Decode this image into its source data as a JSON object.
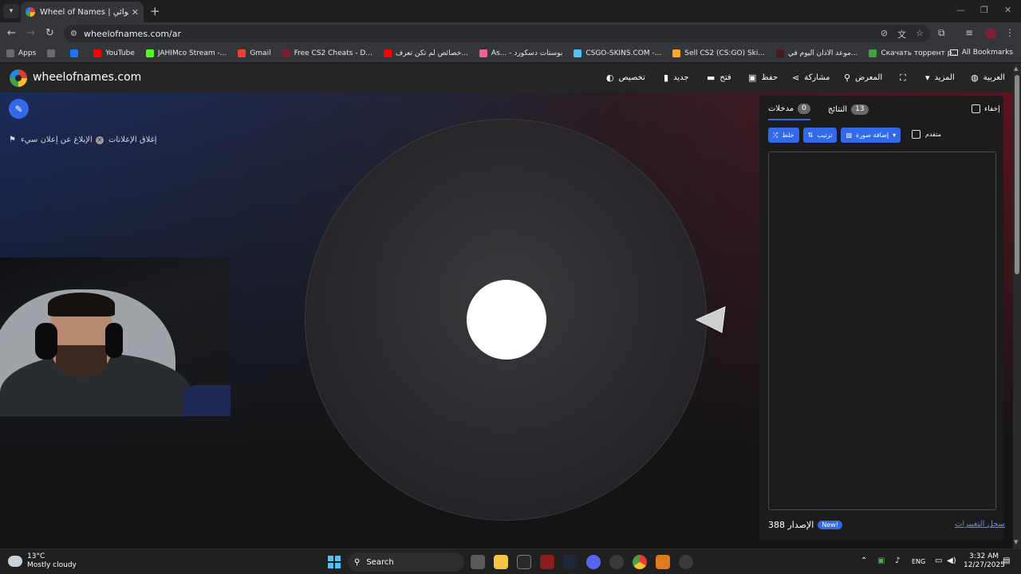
{
  "browser": {
    "tab_title": "Wheel of Names | اسم العشوائي",
    "url": "wheelofnames.com/ar",
    "bookmarks": [
      {
        "label": "Apps",
        "color": "#6a6a6a"
      },
      {
        "label": "",
        "color": "#6a6a6a"
      },
      {
        "label": "",
        "color": "#1877f2"
      },
      {
        "label": "YouTube",
        "color": "#ff0000"
      },
      {
        "label": "JAHIMco Stream -...",
        "color": "#53fc18"
      },
      {
        "label": "Gmail",
        "color": "#ea4335"
      },
      {
        "label": "Free CS2 Cheats - D...",
        "color": "#7b1f2a"
      },
      {
        "label": "خصائص لم تكن تعرف...",
        "color": "#ff0000"
      },
      {
        "label": "As... - بوستات دسكورد",
        "color": "#f06292"
      },
      {
        "label": "CSGO-SKINS.COM -...",
        "color": "#4fc3f7"
      },
      {
        "label": "Sell CS2 (CS:GO) Ski...",
        "color": "#f9a825"
      },
      {
        "label": "موعد الاذان اليوم في...",
        "color": "#4a1a1a"
      },
      {
        "label": "Скачать торрент р...",
        "color": "#43a047"
      }
    ],
    "all_bookmarks": "All Bookmarks"
  },
  "site": {
    "name": "wheelofnames.com",
    "menu": {
      "customize": "تخصيص",
      "new": "جديد",
      "open": "فتح",
      "save": "حفظ",
      "share": "مشاركة",
      "gallery": "المعرض",
      "more": "المزيد",
      "language": "العربية"
    },
    "close_ads": "إغلاق الإعلانات",
    "report_ad": "الإبلاغ عن إعلان سيء"
  },
  "panel": {
    "tab_entries": "مدخلات",
    "entries_count": "0",
    "tab_results": "النتائج",
    "results_count": "13",
    "hide": "إخفاء",
    "shuffle": "خلط",
    "sort": "ترتيب",
    "add_image": "إضافة صورة",
    "advanced": "متقدم",
    "version_label": "الإصدار 388",
    "new_badge": "New!",
    "changelog": "سجل التغييرات"
  },
  "taskbar": {
    "temp": "13°C",
    "weather": "Mostly cloudy",
    "search": "Search",
    "lang": "ENG",
    "time": "3:32 AM",
    "date": "12/27/2025"
  },
  "colors": {
    "accent": "#3369e8",
    "panel_bg": "#1c1c1c"
  }
}
